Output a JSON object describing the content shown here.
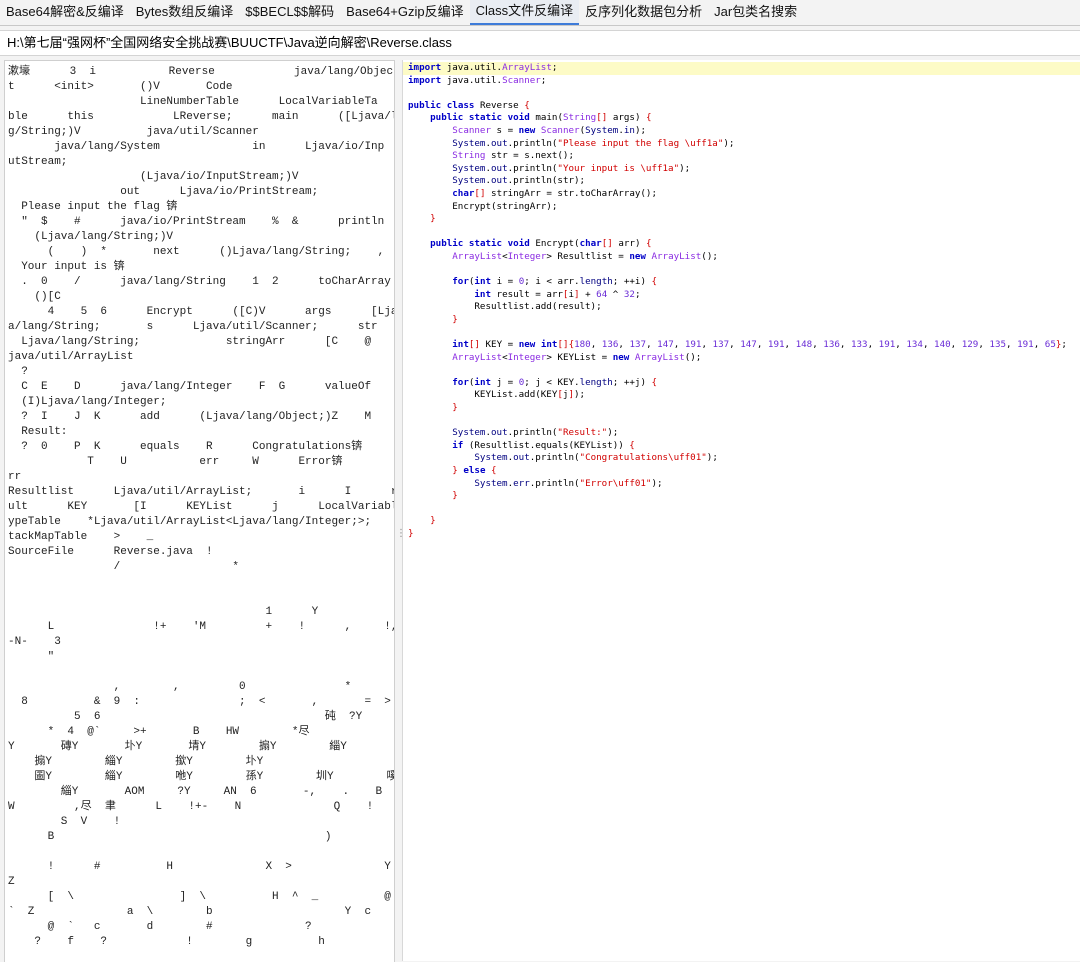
{
  "tabs": [
    {
      "label": "Base64解密&反编译",
      "active": false
    },
    {
      "label": "Bytes数组反编译",
      "active": false
    },
    {
      "label": "$$BECL$$解码",
      "active": false
    },
    {
      "label": "Base64+Gzip反编译",
      "active": false
    },
    {
      "label": "Class文件反编译",
      "active": true
    },
    {
      "label": "反序列化数据包分析",
      "active": false
    },
    {
      "label": "Jar包类名搜索",
      "active": false
    }
  ],
  "file_path": "H:\\第七届“强网杯”全国网络安全挑战赛\\BUUCTF\\Java逆向解密\\Reverse.class",
  "raw_class_view": "漱壕      3  i           Reverse            java/lang/Objec\nt      <init>       ()V       Code\n                    LineNumberTable      LocalVariableTa\nble      this            LReverse;      main      ([Ljava/lan\ng/String;)V          java/util/Scanner\n       java/lang/System              in      Ljava/io/Inp\nutStream;\n                    (Ljava/io/InputStream;)V\n                 out      Ljava/io/PrintStream;\n  Please input the flag 锛\n  \"  $    #      java/io/PrintStream    %  &      println\n    (Ljava/lang/String;)V\n      (    )  *       next      ()Ljava/lang/String;    ,\n  Your input is 锛\n  .  0    /      java/lang/String    1  2      toCharArray\n    ()[C\n      4    5  6      Encrypt      ([C)V      args      [Ljav\na/lang/String;       s      Ljava/util/Scanner;      str\n  Ljava/lang/String;             stringArr      [C    @\njava/util/ArrayList\n  ?\n  C  E    D      java/lang/Integer    F  G      valueOf\n  (I)Ljava/lang/Integer;\n  ?  I    J  K      add      (Ljava/lang/Object;)Z    M\n  Result:\n  ?  0    P  K      equals    R      Congratulations锛\n            T    U           err     W      Error锛        a\nrr\nResultlist      Ljava/util/ArrayList;       i      I      res\nult      KEY       [I      KEYList      j      LocalVariableT\nypeTable    *Ljava/util/ArrayList<Ljava/lang/Integer;>;    S\ntackMapTable    >    _\nSourceFile      Reverse.java  !\n                /                 *\n\n\n                                       1      Y\n      L               !+    'M         +    !      ,     !,\n-N-    3\n      \"\n\n                ,        ,         0               *          1  7\n  8          &  9  :               ;  <       ,       =  >\n          5  6                                  砘  ?Y     AL  =\n      *  4  @`     >+       B    HW        *尽\nY       磚Y       圤Y       埥Y        搧Y        緇Y        埭Y\n    搧Y        緇Y        撳Y        圤Y\n    圖Y        緇Y        咃Y        孫Y        圳Y        嗘Y\n        緇Y       AOM     ?Y     AN  6       -,    .    B    H\nW         ,尽  聿      L    !+-    N              Q    !\n        S  V    !\n      B                                         )\n\n      !      #          H              X  >              Y\nZ\n      [  \\                ]  \\          H  ^  _          @\n`  Z              a  \\        b                    Y  c\n      @  `   c       d        #              ?             e\n    ?    f    ?            !        g          h",
  "source_lines": [
    "import java.util.ArrayList;",
    "import java.util.Scanner;",
    "",
    "public class Reverse {",
    "    public static void main(String[] args) {",
    "        Scanner s = new Scanner(System.in);",
    "        System.out.println(\"Please input the flag \\uff1a\");",
    "        String str = s.next();",
    "        System.out.println(\"Your input is \\uff1a\");",
    "        System.out.println(str);",
    "        char[] stringArr = str.toCharArray();",
    "        Encrypt(stringArr);",
    "    }",
    "",
    "    public static void Encrypt(char[] arr) {",
    "        ArrayList<Integer> Resultlist = new ArrayList();",
    "",
    "        for(int i = 0; i < arr.length; ++i) {",
    "            int result = arr[i] + 64 ^ 32;",
    "            Resultlist.add(result);",
    "        }",
    "",
    "        int[] KEY = new int[]{180, 136, 137, 147, 191, 137, 147, 191, 148, 136, 133, 191, 134, 140, 129, 135, 191, 65};",
    "        ArrayList<Integer> KEYList = new ArrayList();",
    "",
    "        for(int j = 0; j < KEY.length; ++j) {",
    "            KEYList.add(KEY[j]);",
    "        }",
    "",
    "        System.out.println(\"Result:\");",
    "        if (Resultlist.equals(KEYList)) {",
    "            System.out.println(\"Congratulations\\uff01\");",
    "        } else {",
    "            System.err.println(\"Error\\uff01\");",
    "        }",
    "",
    "    }",
    "}"
  ]
}
